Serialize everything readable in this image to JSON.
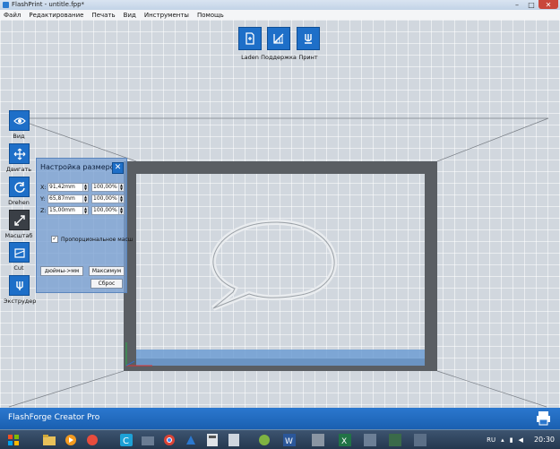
{
  "window": {
    "title": "FlashPrint - untitle.fpp*"
  },
  "menu": [
    "Файл",
    "Редактирование",
    "Печать",
    "Вид",
    "Инструменты",
    "Помощь"
  ],
  "top_toolbar": [
    {
      "label": "Laden",
      "icon": "load-file-icon"
    },
    {
      "label": "Поддержка",
      "icon": "support-icon"
    },
    {
      "label": "Принт",
      "icon": "print-icon"
    }
  ],
  "left_toolbar": [
    {
      "label": "Вид",
      "icon": "eye-icon"
    },
    {
      "label": "Двигать",
      "icon": "move-icon"
    },
    {
      "label": "Drehen",
      "icon": "rotate-icon"
    },
    {
      "label": "Масштаб",
      "icon": "scale-icon",
      "active": true
    },
    {
      "label": "Cut",
      "icon": "cut-icon"
    },
    {
      "label": "Экструдер",
      "icon": "extruder-icon"
    }
  ],
  "size_panel": {
    "title": "Настройка размеров",
    "x_label": "X:",
    "x_value": "91,42mm",
    "x_percent": "100,00%",
    "y_label": "Y:",
    "y_value": "65,87mm",
    "y_percent": "100,00%",
    "z_label": "Z:",
    "z_value": "15,00mm",
    "z_percent": "100,00%",
    "proportional_label": "Пропорциональное масш",
    "proportional_checked": true,
    "inch_button": "дюймы->мм",
    "max_button": "Максимум",
    "reset_button": "Сброс"
  },
  "status": {
    "printer_name": "FlashForge Creator Pro"
  },
  "taskbar": {
    "apps": [
      "start-button",
      "explorer-icon",
      "media-player-icon",
      "app-icon",
      "chrome-icon",
      "flashprint-icon",
      "calc-icon",
      "app2-icon",
      "word-icon",
      "app3-icon",
      "excel-icon",
      "app4-icon"
    ],
    "lang": "RU",
    "time": "20:30"
  },
  "colors": {
    "accent": "#1e6fc8",
    "status_bar": "#1f66b8",
    "grid_bg": "#d1d7de",
    "build_frame": "#5a5e63"
  }
}
